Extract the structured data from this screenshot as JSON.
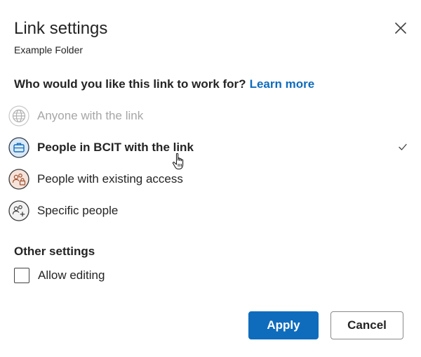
{
  "dialog": {
    "title": "Link settings",
    "subtitle": "Example Folder",
    "question": "Who would you like this link to work for?",
    "learn_more": "Learn more"
  },
  "options": [
    {
      "label": "Anyone with the link",
      "icon": "globe-icon",
      "state": "disabled"
    },
    {
      "label": "People in BCIT with the link",
      "icon": "briefcase-icon",
      "state": "selected"
    },
    {
      "label": "People with existing access",
      "icon": "people-lock-icon",
      "state": "normal"
    },
    {
      "label": "Specific people",
      "icon": "people-add-icon",
      "state": "normal"
    }
  ],
  "other_settings": {
    "heading": "Other settings",
    "allow_editing_label": "Allow editing",
    "allow_editing_checked": false
  },
  "buttons": {
    "apply": "Apply",
    "cancel": "Cancel"
  },
  "colors": {
    "accent": "#0f6cbd",
    "disabled_text": "#a6a6a6",
    "briefcase_icon_bg": "#dbe9f7",
    "people_lock_icon_bg": "#f6e3da"
  }
}
